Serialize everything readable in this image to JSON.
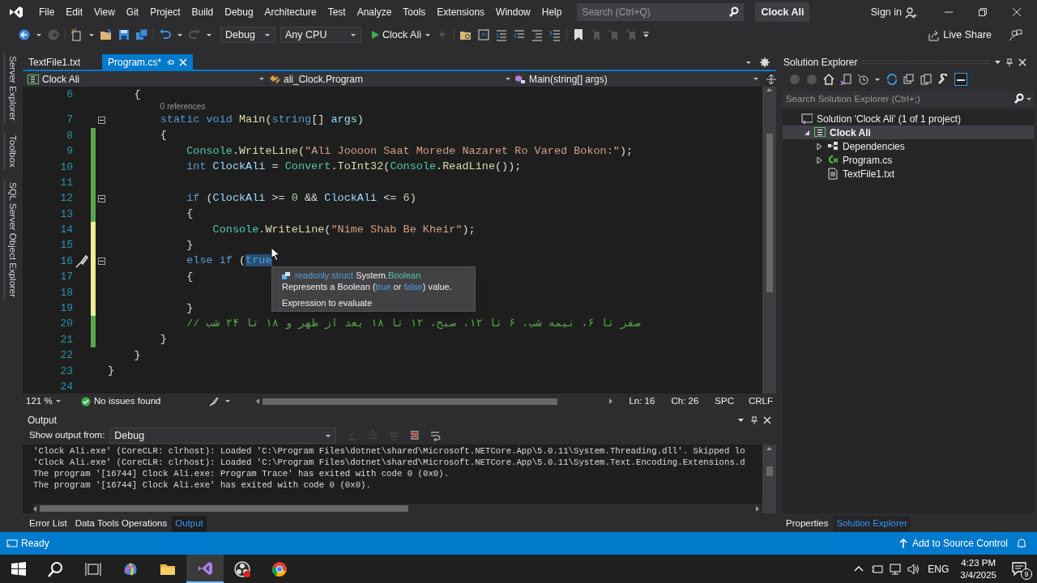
{
  "menu": [
    "File",
    "Edit",
    "View",
    "Git",
    "Project",
    "Build",
    "Debug",
    "Architecture",
    "Test",
    "Analyze",
    "Tools",
    "Extensions",
    "Window",
    "Help"
  ],
  "search": {
    "placeholder": "Search (Ctrl+Q)"
  },
  "window": {
    "title": "Clock Ali"
  },
  "account": {
    "label": "Sign in"
  },
  "toolbar": {
    "configuration": "Debug",
    "platform": "Any CPU",
    "run": "Clock Ali",
    "live_share": "Live Share"
  },
  "side_tabs": [
    "Server Explorer",
    "Toolbox",
    "SQL Server Object Explorer"
  ],
  "doc_tabs": [
    {
      "label": "TextFile1.txt",
      "selected": false
    },
    {
      "label": "Program.cs*",
      "selected": true
    }
  ],
  "nav_bar": {
    "project": "Clock Ali",
    "type": "ali_Clock.Program",
    "member": "Main(string[] args)"
  },
  "code_lines": [
    {
      "kind": "code",
      "number": "6",
      "fold": false,
      "quick_action": false,
      "tokens": [
        {
          "kind": "open_brace",
          "text": "{"
        }
      ]
    },
    {
      "kind": "codelens",
      "text": "0 references"
    },
    {
      "kind": "code",
      "number": "7",
      "fold": true,
      "quick_action": false,
      "tokens": [
        {
          "kind": "keyword",
          "text": "static void "
        },
        {
          "kind": "method",
          "text": "Main"
        },
        {
          "kind": "plain",
          "text": "("
        },
        {
          "kind": "keyword",
          "text": "string"
        },
        {
          "kind": "plain",
          "text": "[] "
        },
        {
          "kind": "param",
          "text": "args"
        },
        {
          "kind": "plain",
          "text": ")"
        }
      ]
    },
    {
      "kind": "code",
      "number": "8",
      "fold": false,
      "color": "#57a64a",
      "quick_action": false,
      "tokens": [
        {
          "kind": "open_brace",
          "text": "{"
        }
      ]
    },
    {
      "kind": "code",
      "number": "9",
      "fold": false,
      "color": "#57a64a",
      "quick_action": false,
      "tokens": [
        {
          "kind": "type",
          "text": "Console"
        },
        {
          "kind": "plain",
          "text": "."
        },
        {
          "kind": "method",
          "text": "WriteLine"
        },
        {
          "kind": "plain",
          "text": "("
        },
        {
          "kind": "string",
          "text": "\"Ali Joooon Saat Morede Nazaret Ro Vared Bokon:\""
        },
        {
          "kind": "plain",
          "text": ");"
        }
      ]
    },
    {
      "kind": "code",
      "number": "10",
      "fold": false,
      "color": "#57a64a",
      "quick_action": false,
      "tokens": [
        {
          "kind": "keyword",
          "text": "int "
        },
        {
          "kind": "param",
          "text": "ClockAli"
        },
        {
          "kind": "plain",
          "text": " = "
        },
        {
          "kind": "type",
          "text": "Convert"
        },
        {
          "kind": "plain",
          "text": "."
        },
        {
          "kind": "method",
          "text": "ToInt32"
        },
        {
          "kind": "plain",
          "text": "("
        },
        {
          "kind": "type",
          "text": "Console"
        },
        {
          "kind": "plain",
          "text": "."
        },
        {
          "kind": "method",
          "text": "ReadLine"
        },
        {
          "kind": "plain",
          "text": "());"
        }
      ]
    },
    {
      "kind": "code",
      "number": "11",
      "fold": false,
      "color": "#57a64a",
      "quick_action": false
    },
    {
      "kind": "code",
      "number": "12",
      "fold": true,
      "color": "#57a64a",
      "quick_action": false,
      "tokens": [
        {
          "kind": "keyword",
          "text": "if"
        },
        {
          "kind": "plain",
          "text": " ("
        },
        {
          "kind": "param",
          "text": "ClockAli"
        },
        {
          "kind": "plain",
          "text": " >= "
        },
        {
          "kind": "number",
          "text": "0"
        },
        {
          "kind": "plain",
          "text": " && "
        },
        {
          "kind": "param",
          "text": "ClockAli"
        },
        {
          "kind": "plain",
          "text": " <= "
        },
        {
          "kind": "number",
          "text": "6"
        },
        {
          "kind": "plain",
          "text": ")"
        }
      ]
    },
    {
      "kind": "code",
      "number": "13",
      "fold": false,
      "color": "#57a64a",
      "quick_action": false,
      "tokens": [
        {
          "kind": "open_brace",
          "text": "{"
        }
      ]
    },
    {
      "kind": "code",
      "number": "14",
      "fold": false,
      "color": "#efef91",
      "quick_action": false,
      "tokens": [
        {
          "kind": "type",
          "text": "Console"
        },
        {
          "kind": "plain",
          "text": "."
        },
        {
          "kind": "method",
          "text": "WriteLine"
        },
        {
          "kind": "plain",
          "text": "("
        },
        {
          "kind": "string",
          "text": "\"Nime Shab Be Kheir\""
        },
        {
          "kind": "plain",
          "text": ");"
        }
      ]
    },
    {
      "kind": "code",
      "number": "15",
      "fold": false,
      "color": "#efef91",
      "quick_action": false,
      "tokens": [
        {
          "kind": "close_brace",
          "text": "}"
        }
      ]
    },
    {
      "kind": "code",
      "number": "16",
      "fold": true,
      "color": "#efef91",
      "quick_action": true,
      "tokens": [
        {
          "kind": "keyword",
          "text": "else if"
        },
        {
          "kind": "plain",
          "text": " ("
        },
        {
          "kind": "selection",
          "text": "true"
        }
      ]
    },
    {
      "kind": "code",
      "number": "17",
      "fold": false,
      "color": "#efef91",
      "quick_action": false,
      "tokens": [
        {
          "kind": "open_brace",
          "text": "{"
        }
      ]
    },
    {
      "kind": "code",
      "number": "18",
      "fold": false,
      "color": "#efef91",
      "quick_action": false
    },
    {
      "kind": "code",
      "number": "19",
      "fold": false,
      "color": "#efef91",
      "quick_action": false,
      "tokens": [
        {
          "kind": "close_brace",
          "text": "}"
        }
      ]
    },
    {
      "kind": "code",
      "number": "20",
      "fold": false,
      "color": "#57a64a",
      "quick_action": false,
      "tokens": [
        {
          "kind": "comment",
          "text": "// صفر تا ۶، نیمه شب، ۶ تا ۱۲، صبح، ۱۲ تا ۱۸ بعد از ظهر و ۱۸ تا ۲۴ شب"
        }
      ]
    },
    {
      "kind": "code",
      "number": "21",
      "fold": false,
      "color": "#57a64a",
      "quick_action": false,
      "tokens": [
        {
          "kind": "close_brace",
          "text": "}"
        }
      ]
    },
    {
      "kind": "code",
      "number": "22",
      "fold": false,
      "quick_action": false,
      "tokens": [
        {
          "kind": "close_brace",
          "text": "}"
        }
      ]
    },
    {
      "kind": "code",
      "number": "23",
      "fold": false,
      "quick_action": false,
      "tokens": [
        {
          "kind": "close_brace",
          "text": "}"
        }
      ]
    },
    {
      "kind": "code",
      "number": "24",
      "fold": false,
      "quick_action": false
    }
  ],
  "tooltip": {
    "signature": [
      {
        "kind": "keyword",
        "text": "readonly struct "
      },
      {
        "kind": "plain",
        "text": "System."
      },
      {
        "kind": "type",
        "text": "Boolean"
      }
    ],
    "description": [
      {
        "kind": "plain",
        "text": "Represents a Boolean ("
      },
      {
        "kind": "keyword",
        "text": "true"
      },
      {
        "kind": "plain",
        "text": " or "
      },
      {
        "kind": "keyword",
        "text": "false"
      },
      {
        "kind": "plain",
        "text": ") value."
      }
    ],
    "note": "Expression to evaluate"
  },
  "editor_status": {
    "zoom": "121 %",
    "issues": "No issues found",
    "line": "Ln: 16",
    "column": "Ch: 26",
    "indent": "SPC",
    "line_ending": "CRLF"
  },
  "output": {
    "title": "Output",
    "source_label": "Show output from:",
    "source": "Debug",
    "lines": [
      "'Clock Ali.exe' (CoreCLR: clrhost): Loaded 'C:\\Program Files\\dotnet\\shared\\Microsoft.NETCore.App\\5.0.11\\System.Threading.dll'. Skipped lo",
      "'Clock Ali.exe' (CoreCLR: clrhost): Loaded 'C:\\Program Files\\dotnet\\shared\\Microsoft.NETCore.App\\5.0.11\\System.Text.Encoding.Extensions.d",
      "The program '[16744] Clock Ali.exe: Program Trace' has exited with code 0 (0x0).",
      "The program '[16744] Clock Ali.exe' has exited with code 0 (0x0)."
    ]
  },
  "bottom_tabs": [
    {
      "label": "Error List",
      "selected": false
    },
    {
      "label": "Data Tools Operations",
      "selected": false
    },
    {
      "label": "Output",
      "selected": true
    }
  ],
  "solution_explorer": {
    "title": "Solution Explorer",
    "search_placeholder": "Search Solution Explorer (Ctrl+;)",
    "tree": [
      {
        "kind": "solution",
        "label": "Solution 'Clock Ali' (1 of 1 project)",
        "selected": false,
        "children": [
          {
            "kind": "project",
            "label": "Clock Ali",
            "selected": true,
            "expanded": true,
            "children": [
              {
                "kind": "dependencies",
                "label": "Dependencies",
                "selected": false,
                "expanded": false
              },
              {
                "kind": "csfile",
                "label": "Program.cs",
                "selected": false,
                "expanded": false
              },
              {
                "kind": "textfile",
                "label": "TextFile1.txt",
                "selected": false
              }
            ]
          }
        ]
      }
    ]
  },
  "right_tabs": [
    {
      "label": "Properties",
      "selected": false
    },
    {
      "label": "Solution Explorer",
      "selected": true
    }
  ],
  "status_bar": {
    "state": "Ready",
    "source_control": "Add to Source Control"
  },
  "taskbar": {
    "apps": [
      {
        "kind": "copilot",
        "active": false
      },
      {
        "kind": "folder",
        "active": false
      },
      {
        "kind": "vs",
        "active": true
      },
      {
        "kind": "obs",
        "active": false
      },
      {
        "kind": "chrome",
        "active": false
      }
    ],
    "language": "ENG",
    "time": "4:23 PM",
    "date": "3/4/2025",
    "notifications": "9"
  }
}
